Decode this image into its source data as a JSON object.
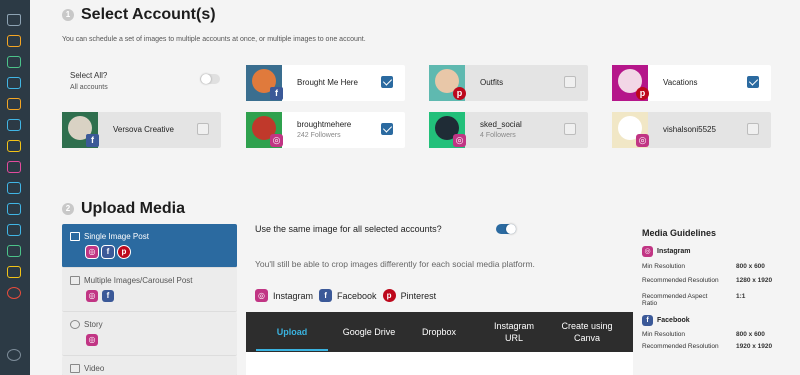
{
  "sidebar": {
    "icons": [
      "home-icon",
      "upload-icon",
      "phone-icon",
      "media-icon",
      "chart-icon",
      "grid-icon",
      "tag-icon",
      "instagram-icon",
      "inbox-icon",
      "network-icon",
      "layers-icon",
      "user-icon",
      "settings-icon",
      "help-icon",
      "power-icon"
    ]
  },
  "section1": {
    "step": "1",
    "title": "Select Account(s)",
    "description": "You can schedule a set of images to multiple accounts at once, or multiple images to one account.",
    "select_all_label": "Select All?",
    "select_all_sub": "All accounts",
    "select_all_on": false
  },
  "accounts": [
    {
      "name": "Brought Me Here",
      "followers": "",
      "platform": "facebook",
      "selected": true
    },
    {
      "name": "Outfits",
      "followers": "",
      "platform": "pinterest",
      "selected": false
    },
    {
      "name": "Vacations",
      "followers": "",
      "platform": "pinterest",
      "selected": true
    },
    {
      "name": "Versova Creative",
      "followers": "",
      "platform": "facebook",
      "selected": false
    },
    {
      "name": "broughtmehere",
      "followers": "242 Followers",
      "platform": "instagram",
      "selected": true
    },
    {
      "name": "sked_social",
      "followers": "4 Followers",
      "platform": "instagram",
      "selected": false
    },
    {
      "name": "vishalsoni5525",
      "followers": "",
      "platform": "instagram",
      "selected": false
    }
  ],
  "section2": {
    "step": "2",
    "title": "Upload Media",
    "same_image_label": "Use the same image for all selected accounts?",
    "same_image_on": true,
    "crop_note": "You'll still be able to crop images differently for each social media platform.",
    "platforms": [
      "Instagram",
      "Facebook",
      "Pinterest"
    ]
  },
  "post_types": [
    {
      "label": "Single Image Post",
      "icon": "image-icon",
      "active": true
    },
    {
      "label": "Multiple Images/Carousel Post",
      "icon": "images-icon",
      "active": false
    },
    {
      "label": "Story",
      "icon": "plus-circle-icon",
      "active": false
    },
    {
      "label": "Video",
      "icon": "video-icon",
      "active": false
    }
  ],
  "upload_tabs": [
    "Upload",
    "Google Drive",
    "Dropbox",
    "Instagram URL",
    "Create using Canva"
  ],
  "guidelines": {
    "title": "Media Guidelines",
    "instagram": {
      "label": "Instagram",
      "rows": [
        {
          "k": "Min Resolution",
          "v": "800 x 600"
        },
        {
          "k": "Recommended Resolution",
          "v": "1280 x 1920"
        },
        {
          "k": "Recommended Aspect Ratio",
          "v": "1:1"
        }
      ]
    },
    "facebook": {
      "label": "Facebook",
      "rows": [
        {
          "k": "Min Resolution",
          "v": "800 x 600"
        },
        {
          "k": "Recommended Resolution",
          "v": "1920 x 1920"
        }
      ]
    }
  },
  "colors": {
    "accent": "#2b6aa0",
    "upload_active": "#3ab3e0",
    "instagram": "#c13584",
    "facebook": "#3b5998",
    "pinterest": "#bd081c"
  }
}
